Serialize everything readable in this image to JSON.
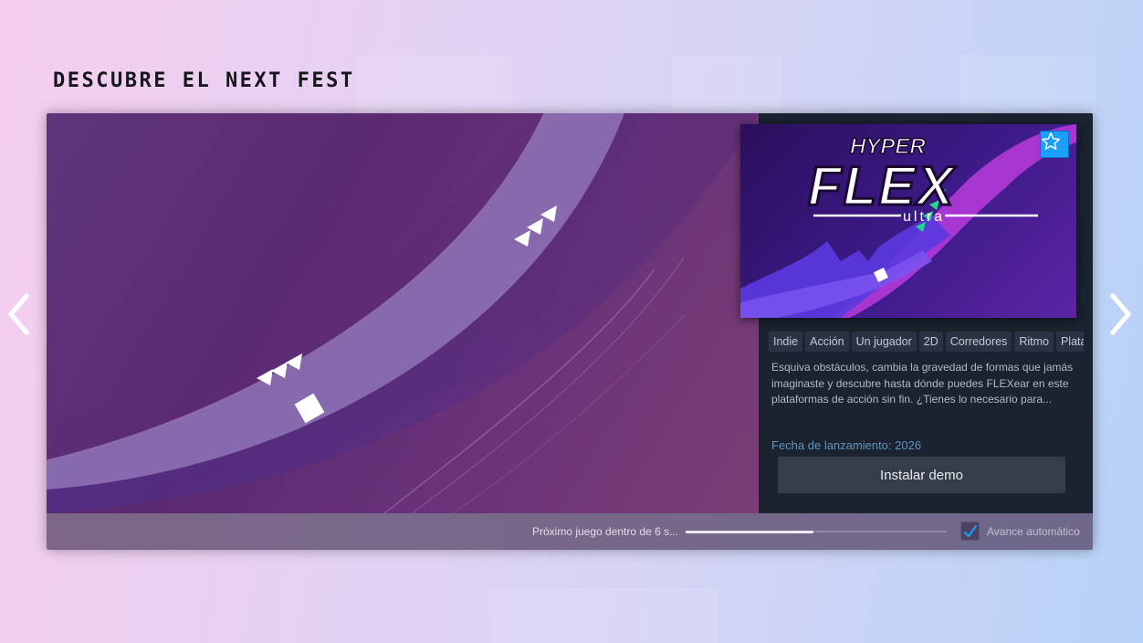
{
  "section": {
    "title": "DESCUBRE EL NEXT FEST"
  },
  "game": {
    "tags": [
      "Indie",
      "Acción",
      "Un jugador",
      "2D",
      "Corredores",
      "Ritmo",
      "Plataformas"
    ],
    "description": "Esquiva obstáculos, cambia la gravedad de formas que jamás imaginaste y descubre hasta dónde puedes FLEXear en este plataformas de acción sin fin. ¿Tienes lo necesario para...",
    "release": "Fecha de lanzamiento: 2026",
    "install_label": "Instalar demo",
    "logo": {
      "line1": "HYPER",
      "line2": "FLEX",
      "line3": "ultra"
    }
  },
  "footer": {
    "next_text": "Próximo juego dentro de 6 s...",
    "progress": 0.49,
    "auto_label": "Avance automático",
    "auto_checked": true
  },
  "colors": {
    "accent": "#1a9fff",
    "link": "#5f95bd",
    "panel": "#1b2230"
  },
  "icons": {
    "prev": "chevron-left-icon",
    "next": "chevron-right-icon",
    "wishlist": "star-icon",
    "check": "checkmark-icon"
  }
}
